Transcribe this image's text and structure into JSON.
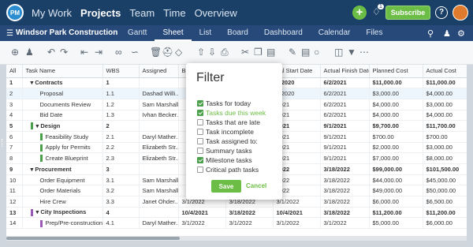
{
  "app": {
    "logo": "PM",
    "nav": [
      "My Work",
      "Projects",
      "Team",
      "Time",
      "Overview"
    ],
    "active_nav": "Projects",
    "notif_count": "1",
    "subscribe": "Subscribe",
    "help": "?"
  },
  "project": {
    "name": "Windsor Park Construction",
    "views": [
      "Gantt",
      "Sheet",
      "List",
      "Board",
      "Dashboard",
      "Calendar",
      "Files"
    ],
    "active_view": "Sheet"
  },
  "columns": [
    "All",
    "Task Name",
    "WBS",
    "Assigned",
    "Ba",
    "",
    "",
    "ual Start Date",
    "Actual Finish Date",
    "Planned Cost",
    "Actual Cost"
  ],
  "rows": [
    {
      "n": "1",
      "name": "Contracts",
      "wbs": "1",
      "assigned": "",
      "c4": "",
      "c5": "",
      "c6": "",
      "start": "9/2020",
      "finish": "6/2/2021",
      "planned": "$11,000.00",
      "actual": "$11,000.00",
      "bold": true,
      "color": "",
      "lvl": 0
    },
    {
      "n": "2",
      "name": "Proposal",
      "wbs": "1.1",
      "assigned": "Dashad Willi...",
      "c4": "",
      "c5": "",
      "c6": "",
      "start": "9/2020",
      "finish": "6/2/2021",
      "planned": "$3,000.00",
      "actual": "$4,000.00",
      "bold": false,
      "color": "",
      "lvl": 1,
      "sel": true
    },
    {
      "n": "3",
      "name": "Documents Review",
      "wbs": "1.2",
      "assigned": "Sam Marshall",
      "c4": "",
      "c5": "",
      "c6": "",
      "start": "2021",
      "finish": "6/2/2021",
      "planned": "$4,000.00",
      "actual": "$3,000.00",
      "bold": false,
      "color": "",
      "lvl": 1
    },
    {
      "n": "4",
      "name": "Bid Date",
      "wbs": "1.3",
      "assigned": "Ivhan Becker...",
      "c4": "",
      "c5": "",
      "c6": "",
      "start": "2021",
      "finish": "6/2/2021",
      "planned": "$4,000.00",
      "actual": "$4,000.00",
      "bold": false,
      "color": "",
      "lvl": 1
    },
    {
      "n": "5",
      "name": "Design",
      "wbs": "2",
      "assigned": "",
      "c4": "",
      "c5": "",
      "c6": "",
      "start": "2021",
      "finish": "9/1/2021",
      "planned": "$9,700.00",
      "actual": "$11,700.00",
      "bold": true,
      "color": "#4aa04a",
      "lvl": 0
    },
    {
      "n": "6",
      "name": "Feasibility Study",
      "wbs": "2.1",
      "assigned": "Daryl Mather...",
      "c4": "",
      "c5": "",
      "c6": "",
      "start": "2021",
      "finish": "9/1/2021",
      "planned": "$700.00",
      "actual": "$700.00",
      "bold": false,
      "color": "#4aa04a",
      "lvl": 1
    },
    {
      "n": "7",
      "name": "Apply for Permits",
      "wbs": "2.2",
      "assigned": "Elizabeth Str...",
      "c4": "",
      "c5": "",
      "c6": "",
      "start": "2021",
      "finish": "9/1/2021",
      "planned": "$2,000.00",
      "actual": "$3,000.00",
      "bold": false,
      "color": "#4aa04a",
      "lvl": 1
    },
    {
      "n": "8",
      "name": "Create Blueprint",
      "wbs": "2.3",
      "assigned": "Elizabeth Str...",
      "c4": "",
      "c5": "",
      "c6": "",
      "start": "2021",
      "finish": "9/1/2021",
      "planned": "$7,000.00",
      "actual": "$8,000.00",
      "bold": false,
      "color": "#4aa04a",
      "lvl": 1
    },
    {
      "n": "9",
      "name": "Procurement",
      "wbs": "3",
      "assigned": "",
      "c4": "",
      "c5": "",
      "c6": "",
      "start": "2022",
      "finish": "3/18/2022",
      "planned": "$99,000.00",
      "actual": "$101,500.00",
      "bold": true,
      "color": "",
      "lvl": 0
    },
    {
      "n": "10",
      "name": "Order Equipment",
      "wbs": "3.1",
      "assigned": "Sam Marshall",
      "c4": "",
      "c5": "",
      "c6": "",
      "start": "2022",
      "finish": "3/18/2022",
      "planned": "$44,000.00",
      "actual": "$45,000.00",
      "bold": false,
      "color": "",
      "lvl": 1
    },
    {
      "n": "11",
      "name": "Order Materials",
      "wbs": "3.2",
      "assigned": "Sam Marshall",
      "c4": "",
      "c5": "",
      "c6": "",
      "start": "2022",
      "finish": "3/18/2022",
      "planned": "$49,000.00",
      "actual": "$50,000.00",
      "bold": false,
      "color": "",
      "lvl": 1
    },
    {
      "n": "12",
      "name": "Hire Crew",
      "wbs": "3.3",
      "assigned": "Janet Ohder...",
      "c4": "3/1/2022",
      "c5": "3/18/2022",
      "c6": "",
      "start": "3/1/2022",
      "finish": "3/18/2022",
      "planned": "$6,000.00",
      "actual": "$6,500.00",
      "bold": false,
      "color": "",
      "lvl": 1
    },
    {
      "n": "13",
      "name": "City Inspections",
      "wbs": "4",
      "assigned": "",
      "c4": "10/4/2021",
      "c5": "3/18/2022",
      "c6": "",
      "start": "10/4/2021",
      "finish": "3/18/2022",
      "planned": "$11,200.00",
      "actual": "$11,200.00",
      "bold": true,
      "color": "#9b59b6",
      "lvl": 0
    },
    {
      "n": "14",
      "name": "Prep/Pre-construction",
      "wbs": "4.1",
      "assigned": "Daryl Mather...",
      "c4": "3/1/2022",
      "c5": "3/1/2022",
      "c6": "",
      "start": "3/1/2022",
      "finish": "3/1/2022",
      "planned": "$5,000.00",
      "actual": "$6,000.00",
      "bold": false,
      "color": "#9b59b6",
      "lvl": 1
    }
  ],
  "filter": {
    "title": "Filter",
    "items": [
      {
        "label": "Tasks for today",
        "checked": true,
        "green": false
      },
      {
        "label": "Tasks due this week",
        "checked": true,
        "green": true
      },
      {
        "label": "Tasks that are late",
        "checked": false,
        "green": false
      },
      {
        "label": "Task incomplete",
        "checked": false,
        "green": false
      },
      {
        "label": "Task assigned to:",
        "checked": false,
        "green": false
      },
      {
        "label": "Summary tasks",
        "checked": false,
        "green": false
      },
      {
        "label": "Milestone tasks",
        "checked": true,
        "green": false
      },
      {
        "label": "Critical path tasks",
        "checked": false,
        "green": false
      }
    ],
    "save": "Save",
    "cancel": "Cancel"
  }
}
